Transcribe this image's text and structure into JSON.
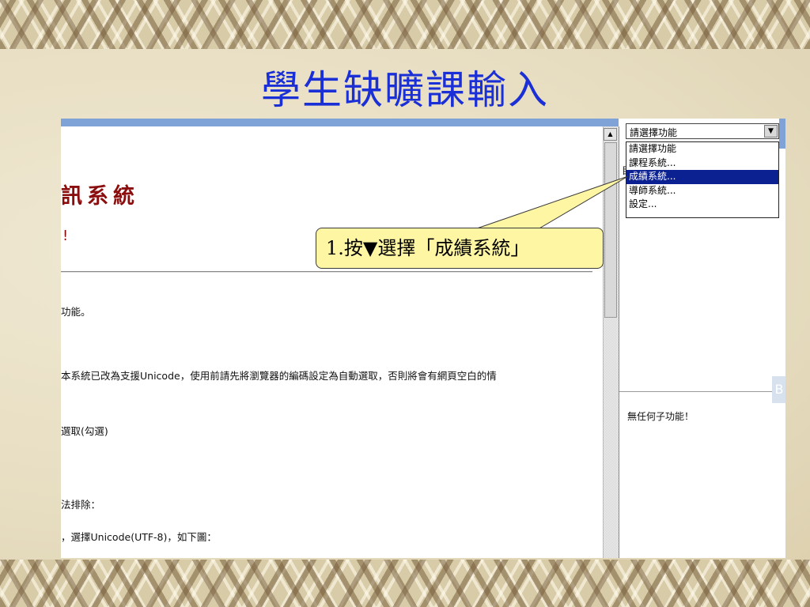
{
  "slide": {
    "title": "學生缺曠課輸入"
  },
  "main": {
    "system_title": "訊系統",
    "subtitle": "!",
    "lines": [
      "功能。",
      "本系統已改為支援Unicode，使用前請先將瀏覽器的編碼設定為自動選取，否則將會有網頁空白的情",
      "選取(勾選)",
      "法排除：",
      "，選擇Unicode(UTF-8)，如下圖："
    ]
  },
  "right": {
    "select_value": "請選擇功能",
    "dropdown_options": [
      "請選擇功能",
      "課程系統...",
      "成績系統...",
      "導師系統...",
      "設定..."
    ],
    "selected_index": 2,
    "partial_letter": "目",
    "no_function_text": "無任何子功能！"
  },
  "callout": {
    "text": "1.按▼選擇「成績系統」"
  },
  "colors": {
    "title": "#1a2fd6",
    "system_title": "#8b0e0e",
    "highlight": "#0b2191",
    "callout_fill": "#fff6a4"
  },
  "icons": {
    "select_button": "chevron-down-icon",
    "scroll_up": "arrow-up-icon"
  }
}
